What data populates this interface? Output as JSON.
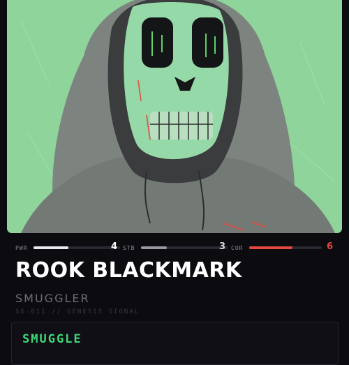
{
  "card": {
    "portrait": {
      "name": "hooded-skull-portrait",
      "bg_color": "#8fd49a"
    },
    "stats": [
      {
        "label": "PWR",
        "value": "4",
        "level": 0.4,
        "color": "#e9e9ee",
        "value_color": "#ffffff"
      },
      {
        "label": "STB",
        "value": "3",
        "level": 0.3,
        "color": "#9a98a3",
        "value_color": "#d6d6dc"
      },
      {
        "label": "COR",
        "value": "6",
        "level": 0.6,
        "color": "#e4483f",
        "value_color": "#e4483f"
      }
    ],
    "name": "ROOK BLACKMARK",
    "role": "SMUGGLER",
    "serial": "SG-011 // GENESIS SIGNAL",
    "ability": {
      "title": "SMUGGLE"
    },
    "colors": {
      "background": "#0c0b10",
      "accent_green": "#3ed778",
      "accent_red": "#e4483f"
    }
  }
}
